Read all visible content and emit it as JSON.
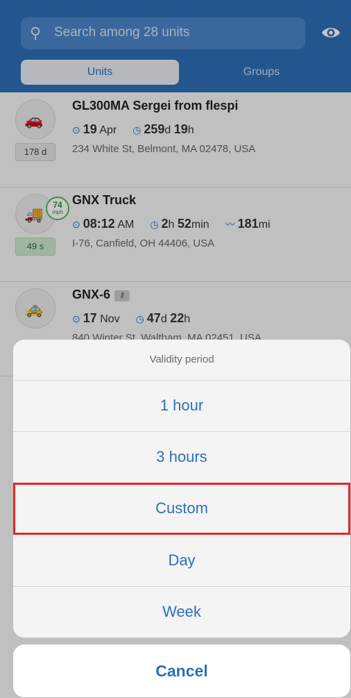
{
  "search": {
    "placeholder": "Search among 28 units"
  },
  "tabs": {
    "units": "Units",
    "groups": "Groups"
  },
  "units": [
    {
      "name": "GL300MA Sergei from flespi",
      "badge": "178 d",
      "date_num": "19",
      "date_unit": "Apr",
      "dur_a": "259",
      "dur_a_unit": "d",
      "dur_b": "19",
      "dur_b_unit": "h",
      "address": "234 White St, Belmont, MA 02478, USA"
    },
    {
      "name": "GNX Truck",
      "badge": "49 s",
      "speed_value": "74",
      "speed_unit": "mph",
      "date_num": "08:12",
      "date_unit": "AM",
      "dur_a": "2",
      "dur_a_unit": "h",
      "dur_b": "52",
      "dur_b_unit": "min",
      "mileage": "181",
      "mileage_unit": "mi",
      "address": "I-76, Canfield, OH 44406, USA"
    },
    {
      "name": "GNX-6",
      "date_num": "17",
      "date_unit": "Nov",
      "dur_a": "47",
      "dur_a_unit": "d",
      "dur_b": "22",
      "dur_b_unit": "h",
      "address": "840 Winter St, Waltham, MA 02451, USA"
    }
  ],
  "sheet": {
    "title": "Validity period",
    "options": [
      "1 hour",
      "3 hours",
      "Custom",
      "Day",
      "Week"
    ],
    "selected": "Custom",
    "cancel": "Cancel"
  },
  "colors": {
    "accent": "#2d6fb8",
    "highlight": "#e1262c",
    "speed": "#56b45b"
  }
}
